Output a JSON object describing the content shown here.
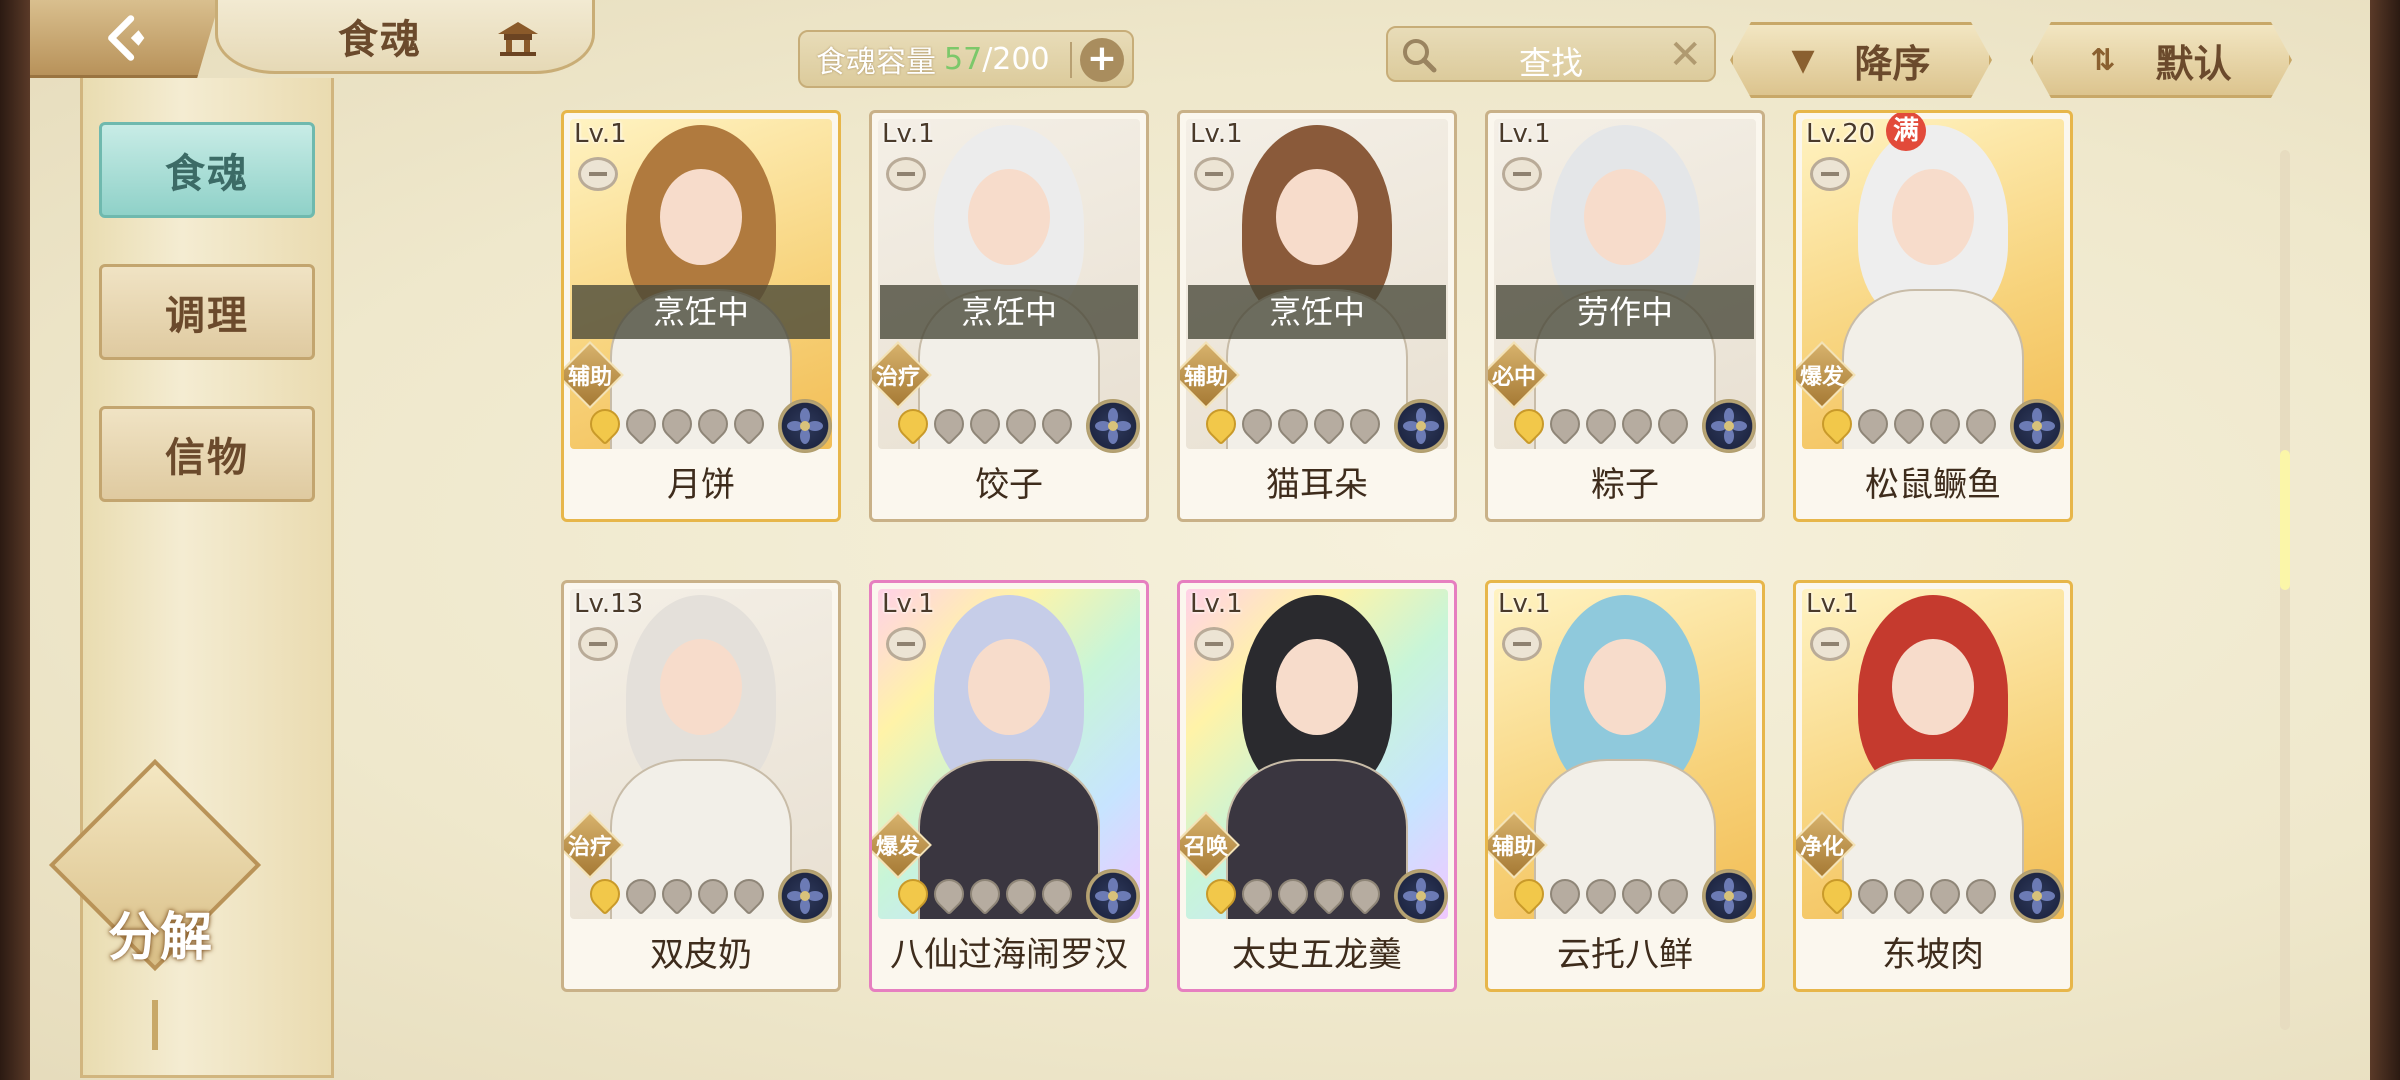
{
  "header": {
    "title": "食魂",
    "capacity_label": "食魂容量",
    "capacity_current": "57",
    "capacity_max": "/200",
    "search_placeholder": "查找",
    "sort_order_label": "降序",
    "sort_mode_label": "默认"
  },
  "sidebar": {
    "items": [
      {
        "label": "食魂",
        "active": true
      },
      {
        "label": "调理",
        "active": false
      },
      {
        "label": "信物",
        "active": false
      }
    ],
    "decompose_label": "分解"
  },
  "colors": {
    "accent_teal": "#8fd1c8",
    "capacity_green": "#7cc86a",
    "gold": "#d7b26c"
  },
  "cards": [
    {
      "level": "Lv.1",
      "name": "月饼",
      "status": "烹饪中",
      "role": "辅助",
      "stars": 1,
      "theme": "gold",
      "hair": "#b07a3e"
    },
    {
      "level": "Lv.1",
      "name": "饺子",
      "status": "烹饪中",
      "role": "治疗",
      "stars": 1,
      "theme": "plain",
      "hair": "#ececec"
    },
    {
      "level": "Lv.1",
      "name": "猫耳朵",
      "status": "烹饪中",
      "role": "辅助",
      "stars": 1,
      "theme": "plain",
      "hair": "#8a5a3a"
    },
    {
      "level": "Lv.1",
      "name": "粽子",
      "status": "劳作中",
      "role": "必中",
      "stars": 1,
      "theme": "plain",
      "hair": "#e4e6e8"
    },
    {
      "level": "Lv.20",
      "name": "松鼠鳜鱼",
      "status": "",
      "role": "爆发",
      "stars": 1,
      "theme": "gold",
      "hair": "#eeeeee",
      "full": "满"
    },
    {
      "level": "Lv.13",
      "name": "双皮奶",
      "status": "",
      "role": "治疗",
      "stars": 1,
      "theme": "plain",
      "hair": "#e4e0da"
    },
    {
      "level": "Lv.1",
      "name": "八仙过海闹罗汉",
      "status": "",
      "role": "爆发",
      "stars": 1,
      "theme": "rainbow",
      "hair": "#c6cde8"
    },
    {
      "level": "Lv.1",
      "name": "太史五龙羹",
      "status": "",
      "role": "召唤",
      "stars": 1,
      "theme": "rainbow",
      "hair": "#2a2a2e"
    },
    {
      "level": "Lv.1",
      "name": "云托八鲜",
      "status": "",
      "role": "辅助",
      "stars": 1,
      "theme": "gold",
      "hair": "#8fc9dc"
    },
    {
      "level": "Lv.1",
      "name": "东坡肉",
      "status": "",
      "role": "净化",
      "stars": 1,
      "theme": "gold",
      "hair": "#c53a2e"
    }
  ]
}
